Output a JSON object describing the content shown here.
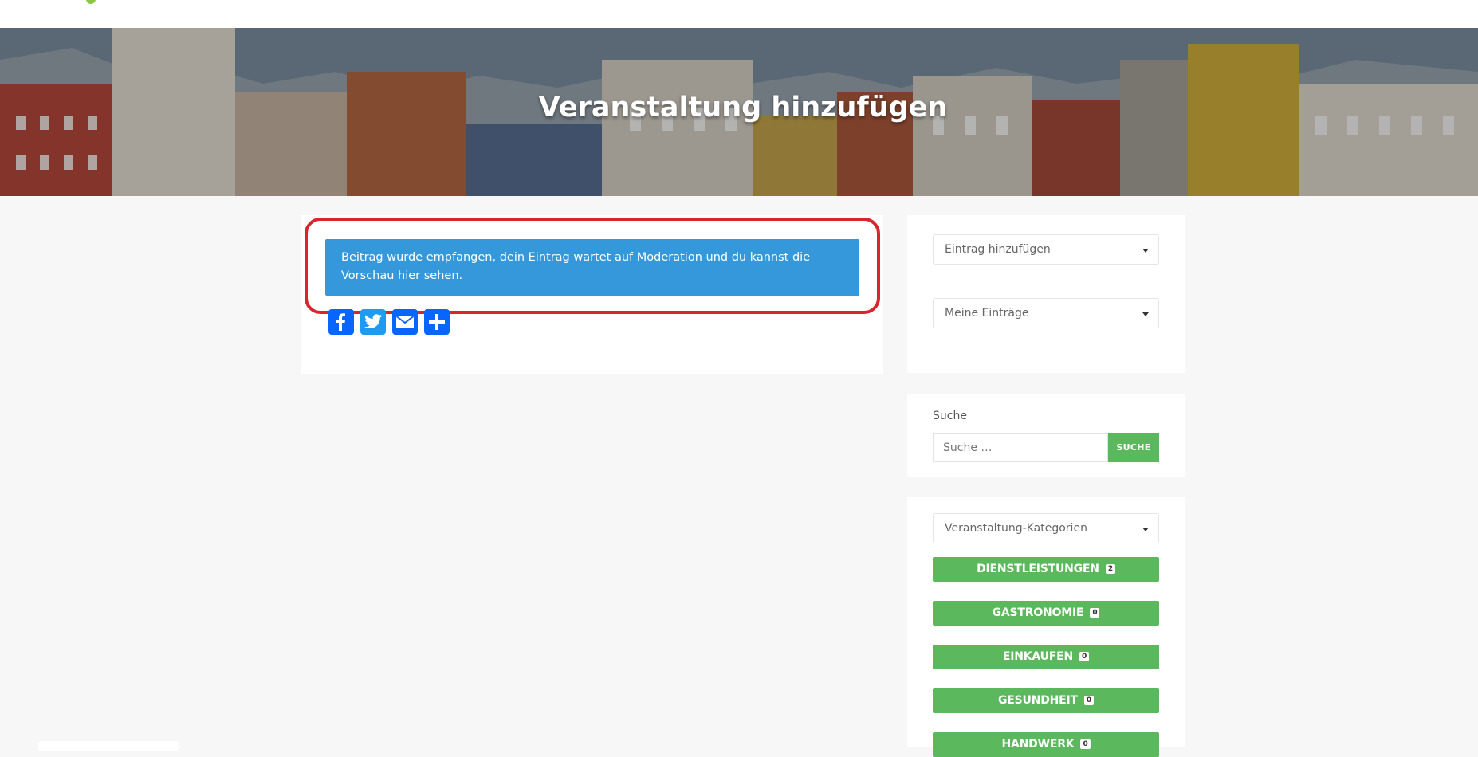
{
  "hero": {
    "title": "Veranstaltung hinzufügen"
  },
  "notice": {
    "text": "Beitrag wurde empfangen, dein Eintrag wartet auf Moderation und du kannst die Vorschau ",
    "link": "hier",
    "suffix": " sehen."
  },
  "share": [
    "facebook-icon",
    "twitter-icon",
    "email-icon",
    "share-plus-icon"
  ],
  "sidebar": {
    "entry_select": "Eintrag hinzufügen",
    "my_entries_select": "Meine Einträge",
    "search_label": "Suche",
    "search_placeholder": "Suche …",
    "search_button": "SUCHE",
    "category_select": "Veranstaltung-Kategorien",
    "categories": [
      {
        "label": "DIENSTLEISTUNGEN",
        "count": "2"
      },
      {
        "label": "GASTRONOMIE",
        "count": "0"
      },
      {
        "label": "EINKAUFEN",
        "count": "0"
      },
      {
        "label": "GESUNDHEIT",
        "count": "0"
      },
      {
        "label": "HANDWERK",
        "count": "0"
      }
    ]
  },
  "colors": {
    "notice_blue": "#3498db",
    "accent_green": "#5cb85c",
    "highlight_red": "#d7262e"
  }
}
